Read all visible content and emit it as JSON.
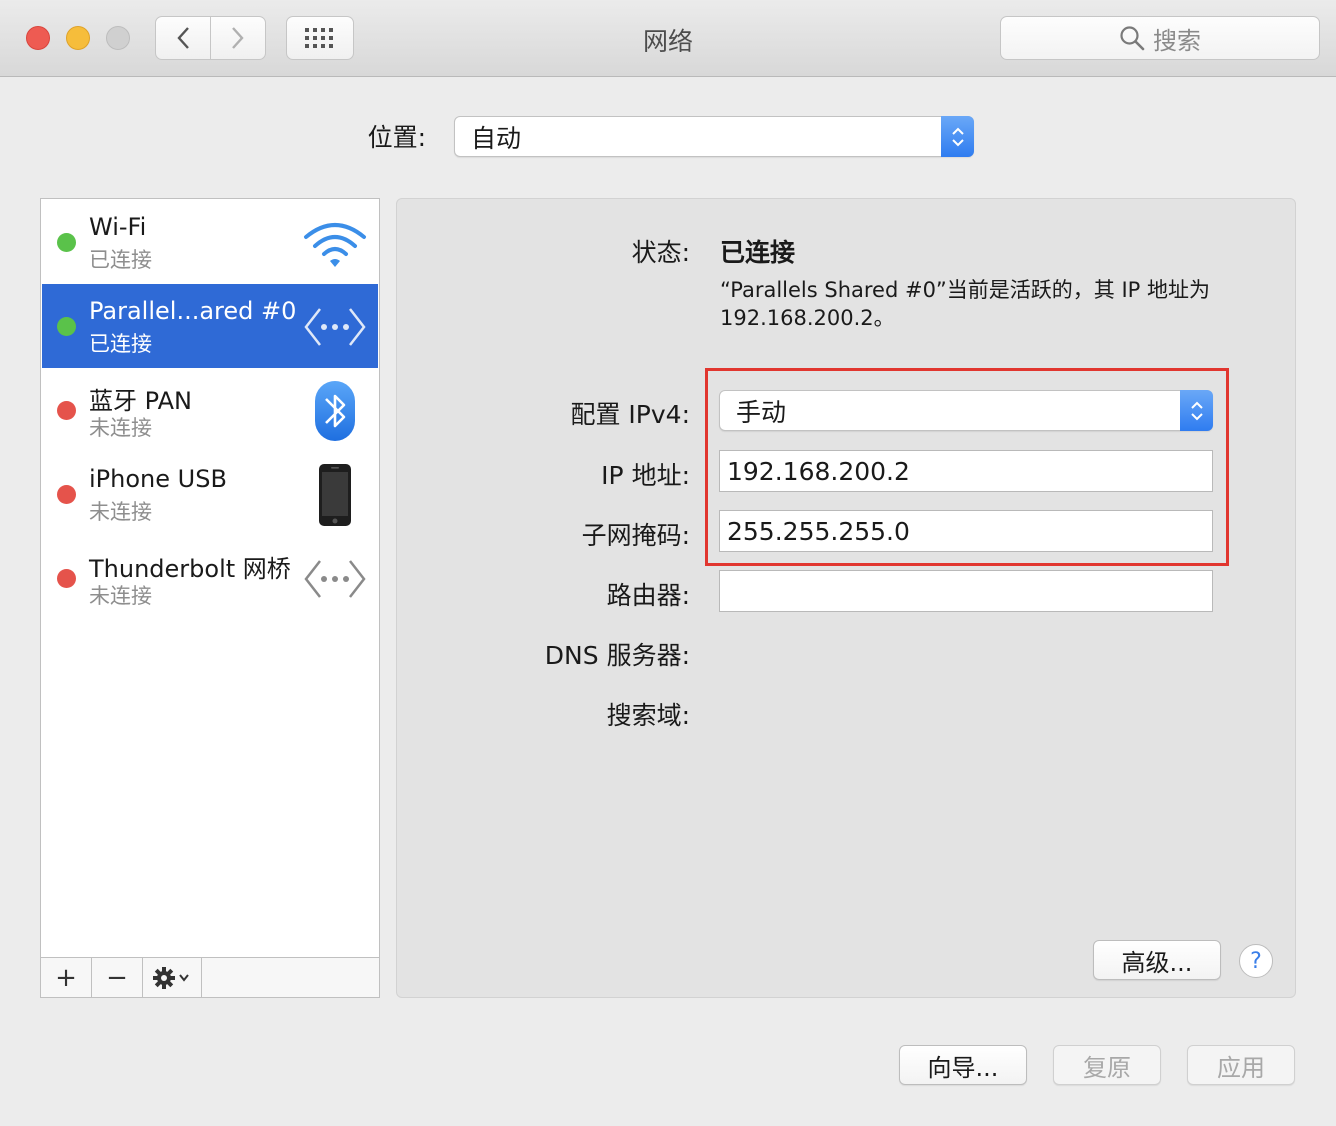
{
  "window": {
    "title": "网络",
    "search_placeholder": "搜索"
  },
  "location": {
    "label": "位置:",
    "value": "自动"
  },
  "services": [
    {
      "name": "Wi-Fi",
      "status": "已连接",
      "state": "connected",
      "icon": "wifi-icon"
    },
    {
      "name": "Parallel...ared #0",
      "status": "已连接",
      "state": "connected",
      "icon": "ethernet-arrows-icon",
      "selected": true
    },
    {
      "name": "蓝牙 PAN",
      "status": "未连接",
      "state": "disconnected",
      "icon": "bluetooth-icon"
    },
    {
      "name": "iPhone USB",
      "status": "未连接",
      "state": "disconnected",
      "icon": "iphone-icon"
    },
    {
      "name": "Thunderbolt 网桥",
      "status": "未连接",
      "state": "disconnected",
      "icon": "ethernet-arrows-icon"
    }
  ],
  "sidebar_toolbar": {
    "add": "+",
    "remove": "−"
  },
  "detail": {
    "status_label": "状态:",
    "status_value": "已连接",
    "status_description": "“Parallels Shared #0”当前是活跃的，其 IP 地址为 192.168.200.2。",
    "configure_label": "配置 IPv4:",
    "configure_value": "手动",
    "ip_label": "IP 地址:",
    "ip_value": "192.168.200.2",
    "subnet_label": "子网掩码:",
    "subnet_value": "255.255.255.0",
    "router_label": "路由器:",
    "router_value": "",
    "dns_label": "DNS 服务器:",
    "search_domain_label": "搜索域:",
    "advanced_button": "高级...",
    "help": "?"
  },
  "footer": {
    "assist": "向导...",
    "revert": "复原",
    "apply": "应用"
  },
  "colors": {
    "connected": "#5ac24a",
    "disconnected": "#e5534b",
    "selection": "#2f6ad6",
    "highlight_border": "#e1362f",
    "accent": "#2f7cf0"
  }
}
